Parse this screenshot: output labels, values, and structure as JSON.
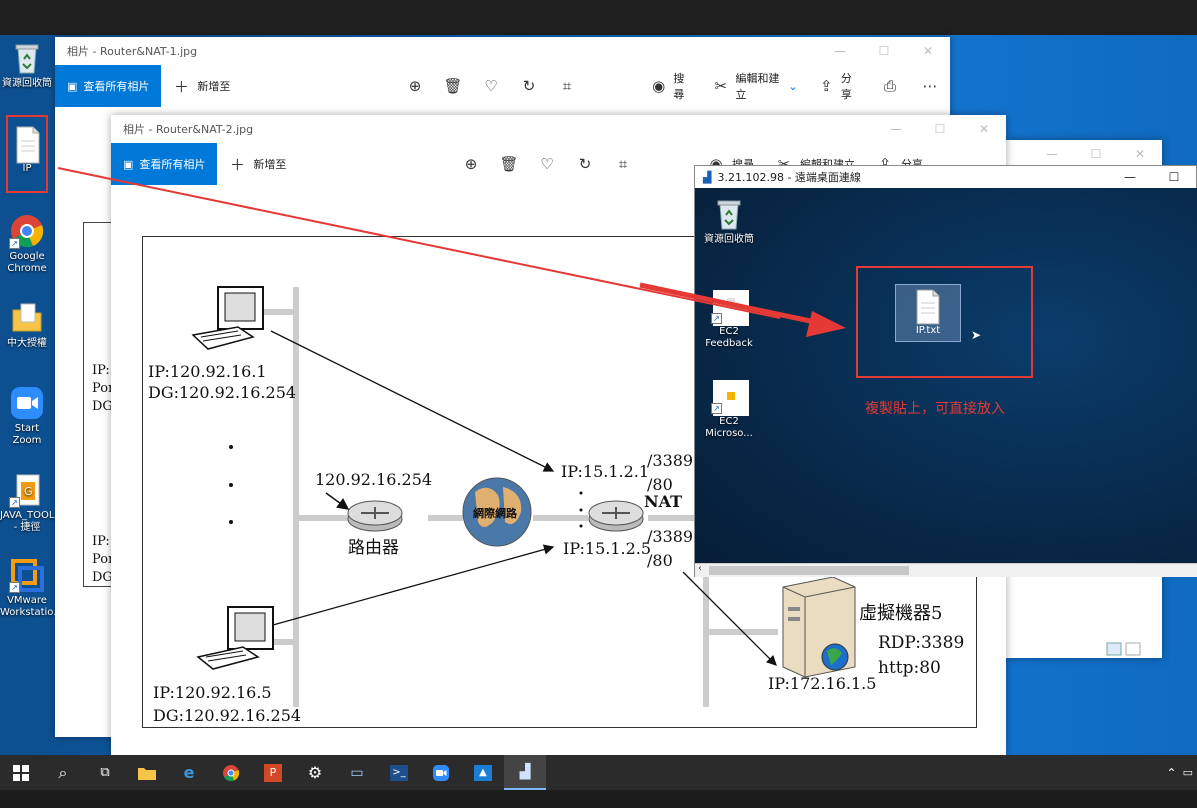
{
  "desktop": {
    "icons": [
      {
        "label": "資源回收筒",
        "icon": "recycle-bin-icon"
      },
      {
        "label": "IP",
        "icon": "text-file-icon"
      },
      {
        "label": "Google Chrome",
        "icon": "chrome-icon"
      },
      {
        "label": "中大授權",
        "icon": "folder-icon"
      },
      {
        "label": "Start Zoom",
        "icon": "zoom-icon"
      },
      {
        "label": "JAVA_TOOL - 捷徑",
        "icon": "java-tool-icon"
      },
      {
        "label": "VMware Workstatio...",
        "icon": "vmware-icon"
      }
    ]
  },
  "photos_window_1": {
    "title": "相片 - Router&NAT-1.jpg",
    "view_all": "查看所有相片",
    "add_to": "新增至",
    "search": "搜尋",
    "edit_create": "編輯和建立",
    "share": "分享",
    "left_labels": [
      "IP:",
      "Por",
      "DG",
      "IP:",
      "Por",
      "DG"
    ]
  },
  "photos_window_2": {
    "title": "相片 - Router&NAT-2.jpg",
    "view_all": "查看所有相片",
    "add_to": "新增至",
    "search": "搜尋",
    "edit_create": "編輯和建立",
    "share": "分享"
  },
  "diagram": {
    "pc1_ip": "IP:120.92.16.1",
    "pc1_dg": "DG:120.92.16.254",
    "pc2_ip": "IP:120.92.16.5",
    "pc2_dg": "DG:120.92.16.254",
    "router_ip": "120.92.16.254",
    "router_label": "路由器",
    "internet_label": "網際網路",
    "nat_ip1": "IP:15.1.2.1",
    "nat_ip2": "IP:15.1.2.5",
    "port_3389_a": "/3389",
    "port_80_a": "/80",
    "port_3389_b": "/3389",
    "port_80_b": "/80",
    "nat_label": "NAT",
    "vm_label": "虛擬機器5",
    "rdp_port": "RDP:3389",
    "http_port": "http:80",
    "server_ip": "IP:172.16.1.5"
  },
  "rdp_window": {
    "title": "3.21.102.98 - 遠端桌面連線",
    "icons": [
      {
        "label": "資源回收筒"
      },
      {
        "label": "EC2 Feedback"
      },
      {
        "label": "EC2 Microso..."
      }
    ],
    "file_label": "IP.txt",
    "annotation": "複製貼上，可直接放入"
  },
  "colors": {
    "accent": "#0078d7",
    "annotation_red": "#e53935"
  }
}
